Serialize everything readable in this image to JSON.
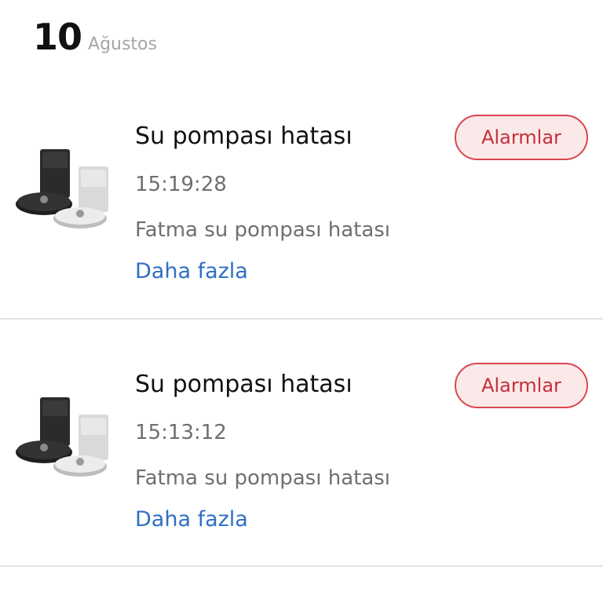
{
  "date": {
    "day": "10",
    "month": "Ağustos"
  },
  "alarms": [
    {
      "title": "Su pompası hatası",
      "time": "15:19:28",
      "description": "Fatma su pompası hatası",
      "more_label": "Daha fazla",
      "button_label": "Alarmlar",
      "device_icon": "robot-vacuum-dock-image"
    },
    {
      "title": "Su pompası hatası",
      "time": "15:13:12",
      "description": "Fatma su pompası hatası",
      "more_label": "Daha fazla",
      "button_label": "Alarmlar",
      "device_icon": "robot-vacuum-dock-image"
    }
  ],
  "colors": {
    "title": "#111111",
    "secondary_text": "#6f6f6f",
    "month_text": "#a6a6a6",
    "link": "#2e6fc4",
    "button_border": "#d9464f",
    "button_fill": "#fbe9ea",
    "button_text": "#c4303a",
    "divider": "#e3e3e3"
  }
}
